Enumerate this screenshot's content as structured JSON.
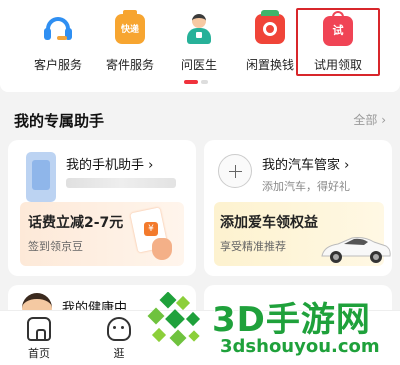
{
  "services": {
    "items": [
      {
        "label": "客户服务",
        "icon": "customer-service-headset-icon"
      },
      {
        "label": "寄件服务",
        "icon": "express-package-icon",
        "icon_text": "快递"
      },
      {
        "label": "问医生",
        "icon": "doctor-icon"
      },
      {
        "label": "闲置换钱",
        "icon": "recycle-money-icon"
      },
      {
        "label": "试用领取",
        "icon": "trial-bag-icon",
        "icon_text": "试",
        "highlighted": true
      }
    ],
    "highlight_color": "#d8262b",
    "pager_active_color": "#f0323c"
  },
  "assistant": {
    "title": "我的专属助手",
    "more": "全部 ›",
    "cards": [
      {
        "name": "我的手机助手 ›",
        "promo_title": "话费立减2-7元",
        "promo_sub": "签到领京豆",
        "coin_text": "¥"
      },
      {
        "name": "我的汽车管家 ›",
        "sub": "添加汽车，得好礼",
        "promo_title": "添加爱车领权益",
        "promo_sub": "享受精准推荐"
      },
      {
        "name": "我的健康中"
      }
    ]
  },
  "tabbar": {
    "tabs": [
      {
        "label": "首页",
        "icon": "home-icon"
      },
      {
        "label": "逛",
        "icon": "stroll-icon"
      }
    ]
  },
  "watermark": {
    "main": "3D手游网",
    "url": "3dshouyou.com",
    "color": "#1fa13b"
  }
}
